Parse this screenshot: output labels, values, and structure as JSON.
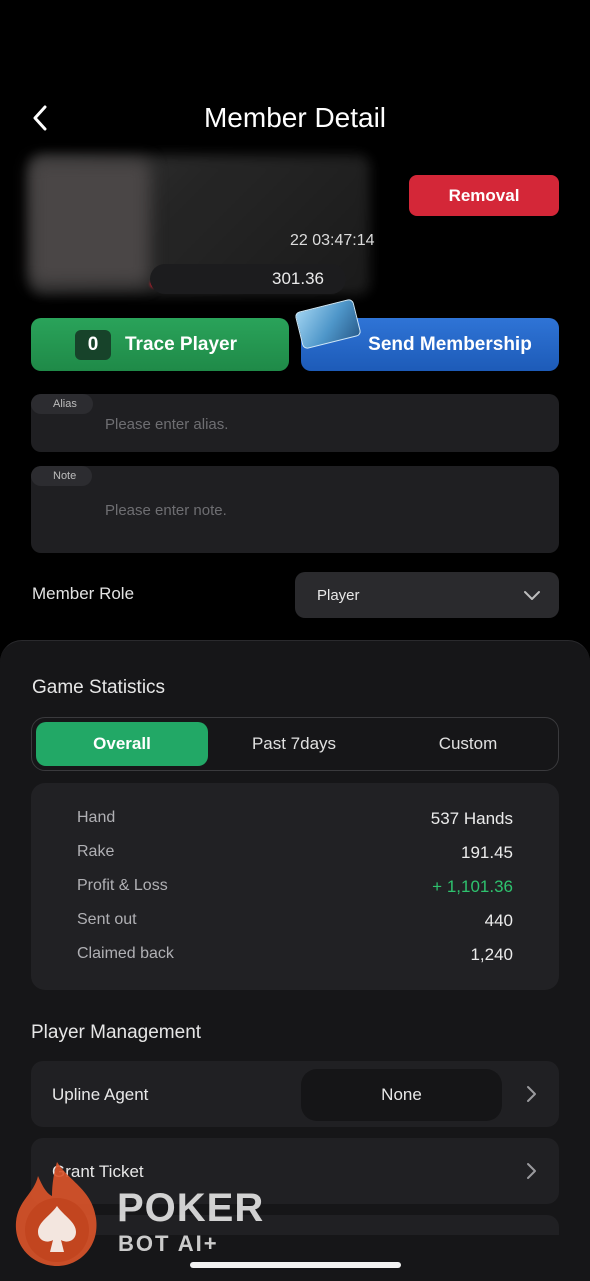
{
  "header": {
    "title": "Member Detail"
  },
  "profile": {
    "time": "22 03:47:14",
    "balance": "301.36"
  },
  "buttons": {
    "removal": "Removal",
    "trace_count": "0",
    "trace": "Trace Player",
    "membership": "Send Membership"
  },
  "alias": {
    "tag": "Alias",
    "placeholder": "Please enter alias."
  },
  "note": {
    "tag": "Note",
    "placeholder": "Please enter note."
  },
  "member_role": {
    "label": "Member Role",
    "value": "Player"
  },
  "game_statistics": {
    "title": "Game Statistics",
    "tabs": [
      "Overall",
      "Past 7days",
      "Custom"
    ],
    "active_tab": "Overall",
    "rows": [
      {
        "label": "Hand",
        "value": "537 Hands"
      },
      {
        "label": "Rake",
        "value": "191.45"
      },
      {
        "label": "Profit & Loss",
        "value": "+ 1,101.36",
        "color": "#2ec26e"
      },
      {
        "label": "Sent out",
        "value": "440"
      },
      {
        "label": "Claimed back",
        "value": "1,240"
      }
    ]
  },
  "player_management": {
    "title": "Player Management",
    "upline_agent": {
      "label": "Upline Agent",
      "value": "None"
    },
    "grant_ticket": {
      "label": "Grant Ticket"
    }
  },
  "watermark": {
    "line1": "POKER",
    "line2": "BOT AI+"
  },
  "colors": {
    "accent_green": "#22a866",
    "removal_red": "#d42738",
    "membership_blue": "#2f74d6"
  }
}
